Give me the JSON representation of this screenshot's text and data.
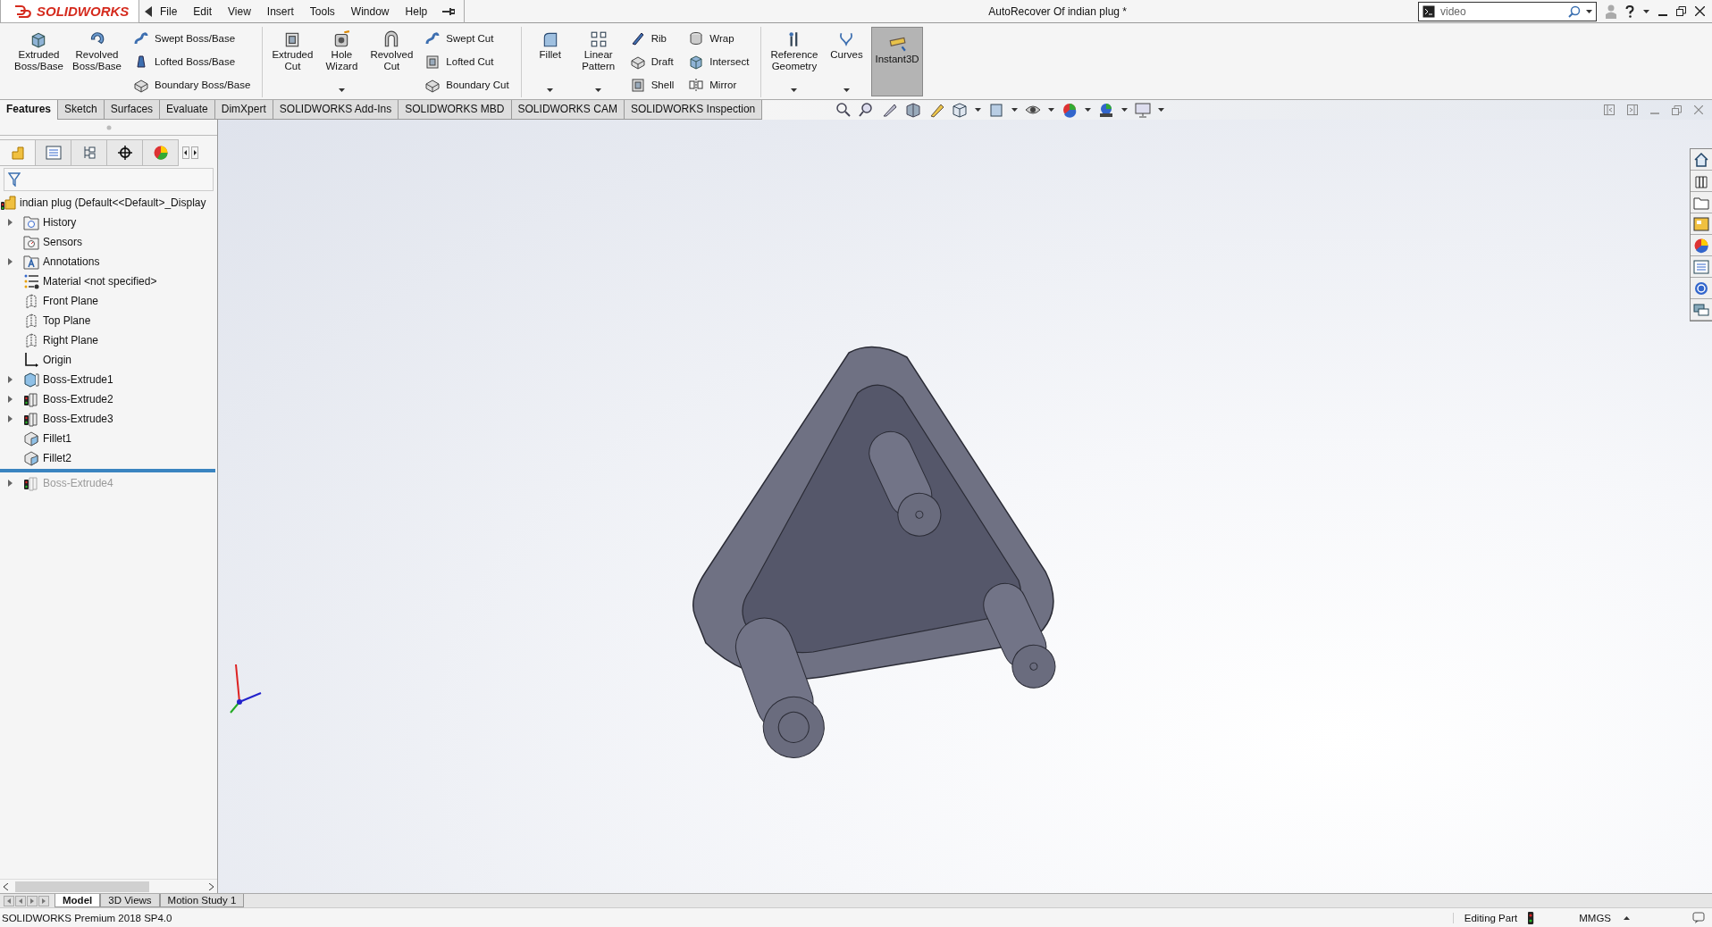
{
  "app": {
    "logo": "SOLIDWORKS"
  },
  "menu": [
    "File",
    "Edit",
    "View",
    "Insert",
    "Tools",
    "Window",
    "Help"
  ],
  "window": {
    "title": "AutoRecover Of indian plug *"
  },
  "search": {
    "value": "video"
  },
  "ribbon": {
    "groups": [
      {
        "large": [
          {
            "label": "Extruded\nBoss/Base",
            "dropdown": false,
            "selected": false
          },
          {
            "label": "Revolved\nBoss/Base",
            "dropdown": false,
            "selected": false
          }
        ],
        "columns": [
          [
            "Swept Boss/Base",
            "Lofted Boss/Base",
            "Boundary Boss/Base"
          ]
        ]
      },
      {
        "large": [
          {
            "label": "Extruded\nCut",
            "dropdown": false,
            "selected": false
          },
          {
            "label": "Hole\nWizard",
            "dropdown": true,
            "selected": false
          },
          {
            "label": "Revolved\nCut",
            "dropdown": false,
            "selected": false
          }
        ],
        "columns": [
          [
            "Swept Cut",
            "Lofted Cut",
            "Boundary Cut"
          ]
        ]
      },
      {
        "large": [
          {
            "label": "Fillet",
            "dropdown": true,
            "selected": false
          },
          {
            "label": "Linear\nPattern",
            "dropdown": true,
            "selected": false
          }
        ],
        "columns": [
          [
            "Rib",
            "Draft",
            "Shell"
          ],
          [
            "Wrap",
            "Intersect",
            "Mirror"
          ]
        ]
      },
      {
        "large": [
          {
            "label": "Reference\nGeometry",
            "dropdown": true,
            "selected": false
          },
          {
            "label": "Curves",
            "dropdown": true,
            "selected": false
          },
          {
            "label": "Instant3D",
            "dropdown": false,
            "selected": true
          }
        ]
      }
    ]
  },
  "command_tabs": [
    {
      "label": "Features",
      "selected": true
    },
    {
      "label": "Sketch",
      "selected": false
    },
    {
      "label": "Surfaces",
      "selected": false
    },
    {
      "label": "Evaluate",
      "selected": false
    },
    {
      "label": "DimXpert",
      "selected": false
    },
    {
      "label": "SOLIDWORKS Add-Ins",
      "selected": false
    },
    {
      "label": "SOLIDWORKS MBD",
      "selected": false
    },
    {
      "label": "SOLIDWORKS CAM",
      "selected": false
    },
    {
      "label": "SOLIDWORKS Inspection",
      "selected": false
    }
  ],
  "manager_tabs": [
    {
      "selected": true
    },
    {
      "selected": false
    },
    {
      "selected": false
    },
    {
      "selected": false
    },
    {
      "selected": false
    }
  ],
  "feature_tree": {
    "root": "indian plug  (Default<<Default>_Display",
    "items": [
      {
        "label": "History",
        "expandable": true,
        "rolled_back": false
      },
      {
        "label": "Sensors",
        "expandable": false,
        "rolled_back": false
      },
      {
        "label": "Annotations",
        "expandable": true,
        "rolled_back": false
      },
      {
        "label": "Material <not specified>",
        "expandable": false,
        "rolled_back": false
      },
      {
        "label": "Front Plane",
        "expandable": false,
        "rolled_back": false
      },
      {
        "label": "Top Plane",
        "expandable": false,
        "rolled_back": false
      },
      {
        "label": "Right Plane",
        "expandable": false,
        "rolled_back": false
      },
      {
        "label": "Origin",
        "expandable": false,
        "rolled_back": false
      },
      {
        "label": "Boss-Extrude1",
        "expandable": true,
        "rolled_back": false
      },
      {
        "label": "Boss-Extrude2",
        "expandable": true,
        "rolled_back": false
      },
      {
        "label": "Boss-Extrude3",
        "expandable": true,
        "rolled_back": false
      },
      {
        "label": "Fillet1",
        "expandable": false,
        "rolled_back": false
      },
      {
        "label": "Fillet2",
        "expandable": false,
        "rolled_back": false
      },
      {
        "label": "Boss-Extrude4",
        "expandable": true,
        "rolled_back": true
      }
    ]
  },
  "bottom_tabs": [
    {
      "label": "Model",
      "selected": true
    },
    {
      "label": "3D Views",
      "selected": false
    },
    {
      "label": "Motion Study 1",
      "selected": false
    }
  ],
  "status_bar": {
    "product": "SOLIDWORKS Premium 2018 SP4.0",
    "mode": "Editing Part",
    "units": "MMGS"
  }
}
